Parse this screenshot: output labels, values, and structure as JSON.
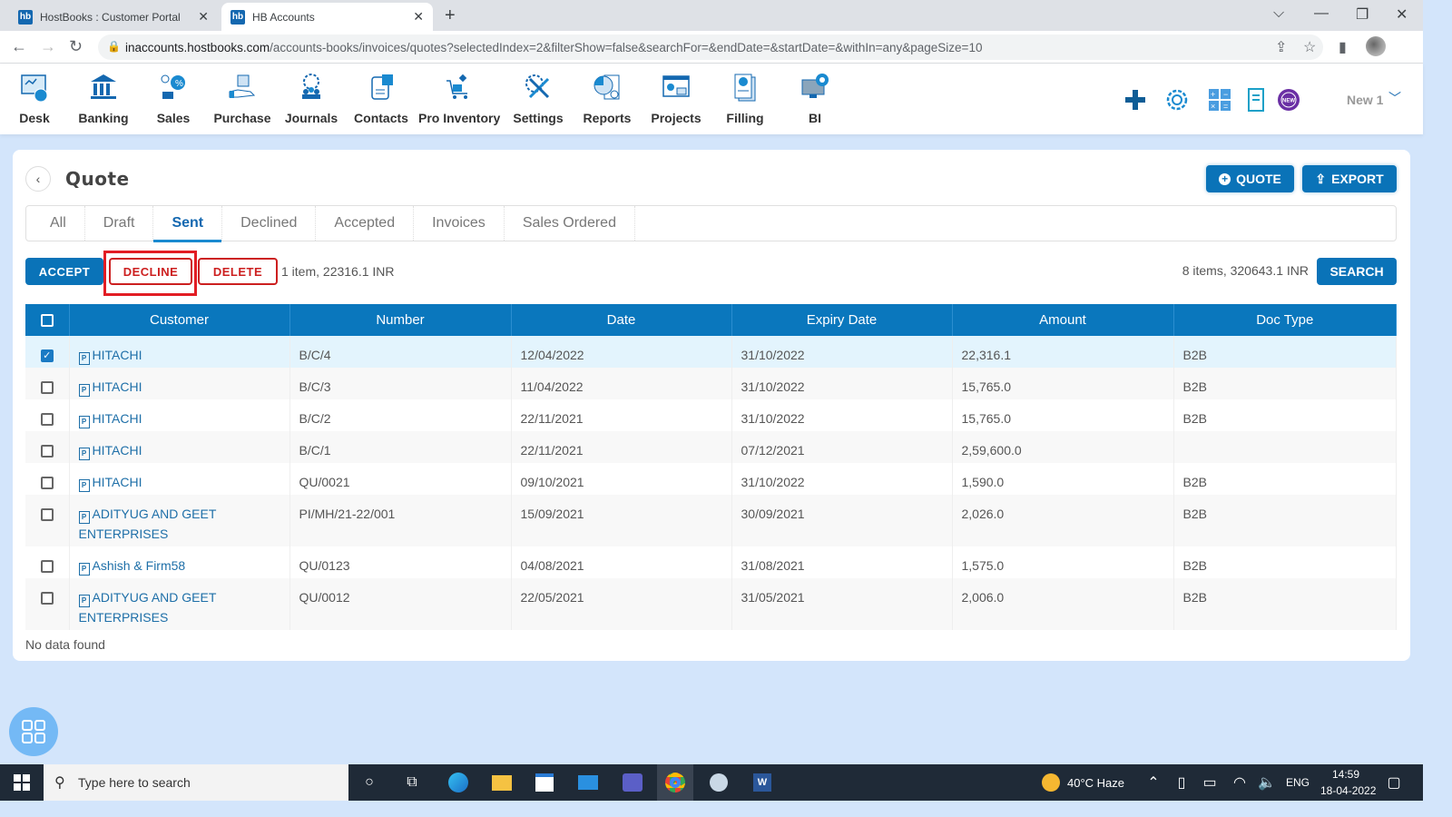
{
  "browser": {
    "tabs": [
      {
        "label": "HostBooks : Customer Portal",
        "favicon": "hb",
        "active": false
      },
      {
        "label": "HB Accounts",
        "favicon": "hb",
        "active": true
      }
    ],
    "url_host": "inaccounts.hostbooks.com",
    "url_path": "/accounts-books/invoices/quotes?selectedIndex=2&filterShow=false&searchFor=&endDate=&startDate=&withIn=any&pageSize=10"
  },
  "appnav": {
    "items": [
      {
        "label": "Desk",
        "icon": "desk-icon"
      },
      {
        "label": "Banking",
        "icon": "bank-icon"
      },
      {
        "label": "Sales",
        "icon": "sales-icon"
      },
      {
        "label": "Purchase",
        "icon": "purchase-icon"
      },
      {
        "label": "Journals",
        "icon": "journals-icon"
      },
      {
        "label": "Contacts",
        "icon": "contacts-icon"
      },
      {
        "label": "Pro Inventory",
        "icon": "inventory-icon"
      },
      {
        "label": "Settings",
        "icon": "settings-icon"
      },
      {
        "label": "Reports",
        "icon": "reports-icon"
      },
      {
        "label": "Projects",
        "icon": "projects-icon"
      },
      {
        "label": "Filling",
        "icon": "filling-icon"
      },
      {
        "label": "BI",
        "icon": "bi-icon"
      }
    ],
    "new_label": "New 1",
    "new_badge": "NEW"
  },
  "page": {
    "title": "Quote",
    "quote_button": "QUOTE",
    "export_button": "EXPORT",
    "tabs": [
      "All",
      "Draft",
      "Sent",
      "Declined",
      "Accepted",
      "Invoices",
      "Sales Ordered"
    ],
    "active_tab": "Sent",
    "accept_button": "ACCEPT",
    "decline_button": "DECLINE",
    "delete_button": "DELETE",
    "selection_info": "1 item, 22316.1 INR",
    "total_info": "8 items, 320643.1 INR",
    "search_button": "SEARCH",
    "no_data": "No data found"
  },
  "table": {
    "headers": [
      "Customer",
      "Number",
      "Date",
      "Expiry Date",
      "Amount",
      "Doc Type"
    ],
    "rows": [
      {
        "checked": true,
        "customer": "HITACHI",
        "number": "B/C/4",
        "date": "12/04/2022",
        "expiry": "31/10/2022",
        "amount": "22,316.1",
        "doc_type": "B2B"
      },
      {
        "checked": false,
        "customer": "HITACHI",
        "number": "B/C/3",
        "date": "11/04/2022",
        "expiry": "31/10/2022",
        "amount": "15,765.0",
        "doc_type": "B2B"
      },
      {
        "checked": false,
        "customer": "HITACHI",
        "number": "B/C/2",
        "date": "22/11/2021",
        "expiry": "31/10/2022",
        "amount": "15,765.0",
        "doc_type": "B2B"
      },
      {
        "checked": false,
        "customer": "HITACHI",
        "number": "B/C/1",
        "date": "22/11/2021",
        "expiry": "07/12/2021",
        "amount": "2,59,600.0",
        "doc_type": ""
      },
      {
        "checked": false,
        "customer": "HITACHI",
        "number": "QU/0021",
        "date": "09/10/2021",
        "expiry": "31/10/2022",
        "amount": "1,590.0",
        "doc_type": "B2B"
      },
      {
        "checked": false,
        "customer": "ADITYUG AND GEET ENTERPRISES",
        "number": "PI/MH/21-22/001",
        "date": "15/09/2021",
        "expiry": "30/09/2021",
        "amount": "2,026.0",
        "doc_type": "B2B"
      },
      {
        "checked": false,
        "customer": "Ashish & Firm58",
        "number": "QU/0123",
        "date": "04/08/2021",
        "expiry": "31/08/2021",
        "amount": "1,575.0",
        "doc_type": "B2B"
      },
      {
        "checked": false,
        "customer": "ADITYUG AND GEET ENTERPRISES",
        "number": "QU/0012",
        "date": "22/05/2021",
        "expiry": "31/05/2021",
        "amount": "2,006.0",
        "doc_type": "B2B"
      }
    ]
  },
  "taskbar": {
    "search_placeholder": "Type here to search",
    "weather": "40°C  Haze",
    "language": "ENG",
    "time": "14:59",
    "date": "18-04-2022"
  },
  "colors": {
    "primary": "#0a73b8",
    "danger": "#cc1f1f",
    "selected_row": "#e3f4fd",
    "page_bg": "#d3e5fb"
  }
}
